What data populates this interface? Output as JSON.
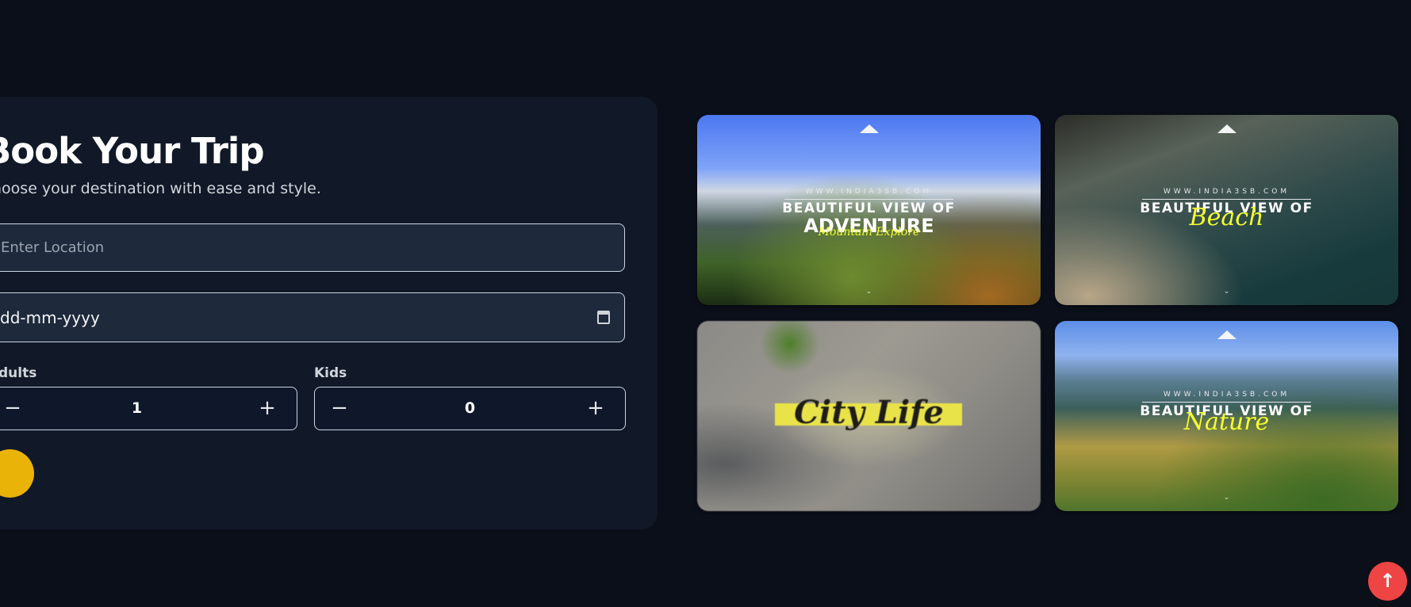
{
  "booking": {
    "title": "Book Your Trip",
    "subtitle": "hoose your destination with ease and style.",
    "location_placeholder": "Enter Location",
    "date_value": "dd-mm-yyyy",
    "adults_label": "dults",
    "adults_value": "1",
    "kids_label": "Kids",
    "kids_value": "0",
    "minus_symbol": "−",
    "plus_symbol": "+",
    "submit_color": "#eab308"
  },
  "gallery": [
    {
      "website": "WWW.INDIA3SB.COM",
      "heading": "BEAUTIFUL VIEW OF",
      "main": "ADVENTURE",
      "script": "Mountain Explore",
      "chevron": "⌄"
    },
    {
      "website": "WWW.INDIA3SB.COM",
      "heading": "BEAUTIFUL VIEW OF",
      "script": "Beach",
      "chevron": "⌄"
    },
    {
      "script": "City Life"
    },
    {
      "website": "WWW.INDIA3SB.COM",
      "heading": "BEAUTIFUL VIEW OF",
      "script": "Nature",
      "chevron": "⌄"
    }
  ],
  "scroll_top": {
    "icon": "arrow-up-icon",
    "glyph": "↑",
    "color": "#ef4444"
  },
  "colors": {
    "background": "#0b0f19",
    "panel": "#111827",
    "accent": "#eab308"
  }
}
